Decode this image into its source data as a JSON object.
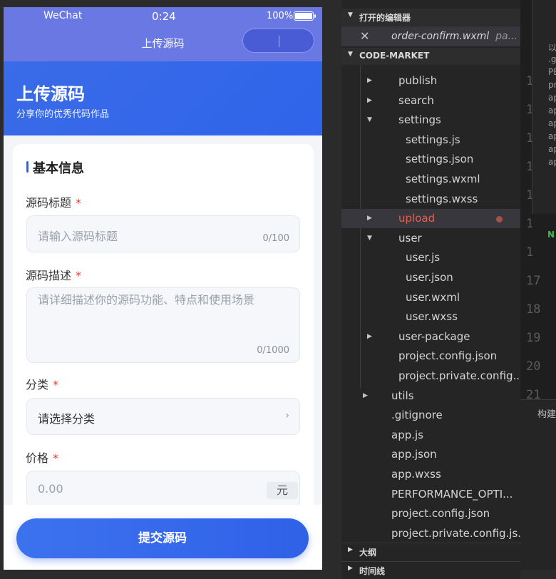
{
  "phone": {
    "status": {
      "carrier": "WeChat",
      "time": "0:24",
      "battery": "100%"
    },
    "nav_title": "上传源码",
    "header": {
      "title": "上传源码",
      "subtitle": "分享你的优秀代码作品"
    },
    "section_title": "基本信息",
    "fields": {
      "title": {
        "label": "源码标题",
        "required": "*",
        "placeholder": "请输入源码标题",
        "count": "0/100"
      },
      "description": {
        "label": "源码描述",
        "required": "*",
        "placeholder": "请详细描述你的源码功能、特点和使用场景",
        "count": "0/1000"
      },
      "category": {
        "label": "分类",
        "required": "*",
        "value": "请选择分类",
        "chevron": "›"
      },
      "price": {
        "label": "价格",
        "required": "*",
        "placeholder": "0.00",
        "unit": "元"
      }
    },
    "submit_label": "提交源码"
  },
  "explorer": {
    "open_editors_header": "打开的编辑器",
    "open_editor": {
      "close": "✕",
      "filename": "order-confirm.wxml",
      "path": "pa..."
    },
    "project_header": "CODE-MARKET",
    "tree": [
      {
        "name": "publish",
        "type": "folder",
        "expanded": false
      },
      {
        "name": "search",
        "type": "folder",
        "expanded": false
      },
      {
        "name": "settings",
        "type": "folder",
        "expanded": true
      },
      {
        "name": "settings.js",
        "type": "file"
      },
      {
        "name": "settings.json",
        "type": "file"
      },
      {
        "name": "settings.wxml",
        "type": "file"
      },
      {
        "name": "settings.wxss",
        "type": "file"
      },
      {
        "name": "upload",
        "type": "folder",
        "expanded": false,
        "modified": true
      },
      {
        "name": "user",
        "type": "folder",
        "expanded": true
      },
      {
        "name": "user.js",
        "type": "file"
      },
      {
        "name": "user.json",
        "type": "file"
      },
      {
        "name": "user.wxml",
        "type": "file"
      },
      {
        "name": "user.wxss",
        "type": "file"
      },
      {
        "name": "user-package",
        "type": "folder",
        "expanded": false
      },
      {
        "name": "project.config.json",
        "type": "file"
      },
      {
        "name": "project.private.config....",
        "type": "file"
      },
      {
        "name": "utils",
        "type": "folder",
        "expanded": false
      },
      {
        "name": ".gitignore",
        "type": "file"
      },
      {
        "name": "app.js",
        "type": "file"
      },
      {
        "name": "app.json",
        "type": "file"
      },
      {
        "name": "app.wxss",
        "type": "file"
      },
      {
        "name": "PERFORMANCE_OPTI...",
        "type": "file"
      },
      {
        "name": "project.config.json",
        "type": "file"
      },
      {
        "name": "project.private.config.js...",
        "type": "file"
      }
    ],
    "outline_header": "大纲",
    "timeline_header": "时间线"
  },
  "editor": {
    "line_numbers": [
      "1",
      "1",
      "1",
      "1",
      "1",
      "1",
      "1",
      "17",
      "18",
      "19",
      "20",
      "21"
    ],
    "popup_lines": [
      "以",
      ".g",
      "PE",
      "pr",
      "ap",
      "ap",
      "ap",
      "ap",
      "ap",
      "ap"
    ],
    "badge": "N",
    "build_label": "构建"
  },
  "colors": {
    "accent": "#2f64ea",
    "nav": "#6a78e4",
    "required": "#e53935",
    "modified": "#e0624e"
  }
}
